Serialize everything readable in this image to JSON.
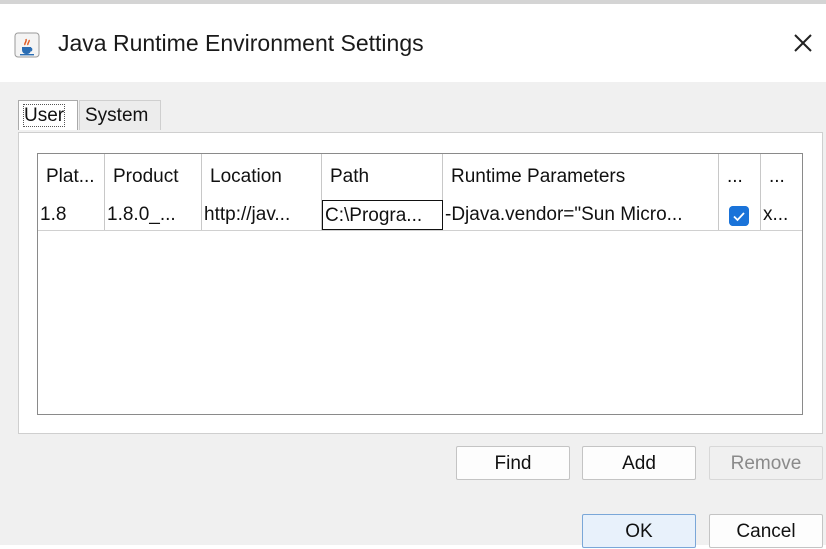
{
  "window": {
    "title": "Java Runtime Environment Settings",
    "icon": "java-cup-icon",
    "close_icon": "close-icon"
  },
  "tabs": [
    {
      "label": "User",
      "active": true
    },
    {
      "label": "System",
      "active": false
    }
  ],
  "table": {
    "columns": [
      "Plat...",
      "Product",
      "Location",
      "Path",
      "Runtime Parameters",
      "...",
      "..."
    ],
    "rows": [
      {
        "platform": "1.8",
        "product": "1.8.0_...",
        "location": "http://jav...",
        "path": "C:\\Progra...",
        "runtime_parameters": "-Djava.vendor=\"Sun Micro...",
        "enabled": true,
        "architecture": "x..."
      }
    ]
  },
  "buttons": {
    "find": "Find",
    "add": "Add",
    "remove": "Remove",
    "ok": "OK",
    "cancel": "Cancel"
  },
  "colors": {
    "checkbox_accent": "#1a73d9",
    "window_bg": "#f0f0f0"
  }
}
